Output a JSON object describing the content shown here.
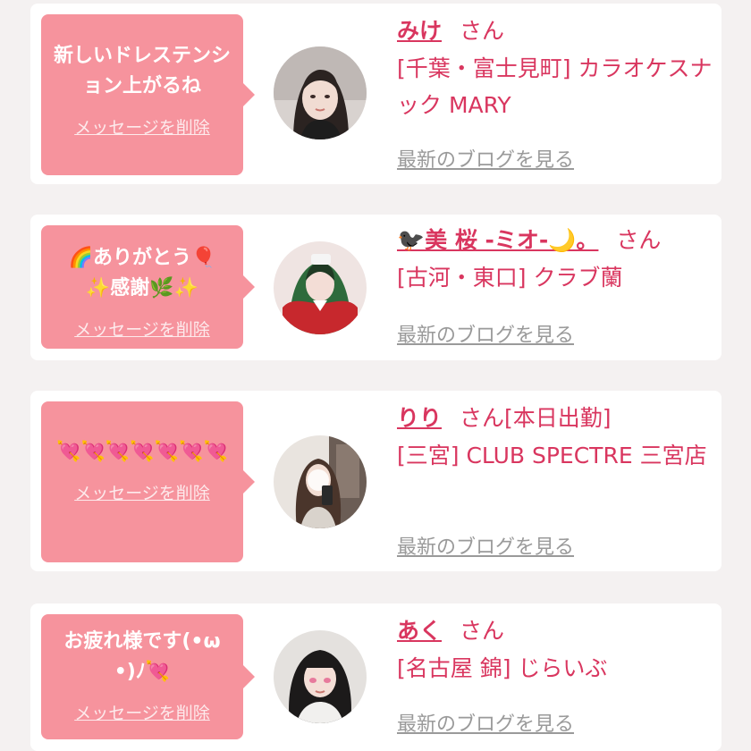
{
  "colors": {
    "page_bg": "#f4f1f1",
    "card_bg": "#ffffff",
    "bubble_bg": "#f6939d",
    "accent": "#d9365f",
    "link_gray": "#9a9a9a"
  },
  "entries": [
    {
      "message": "新しいドレステンション上がるね",
      "delete_label": "メッセージを削除",
      "name": "みけ",
      "honorific": "さん",
      "status": "",
      "shop": "[千葉・富士見町] カラオケスナック MARY",
      "blog_label": "最新のブログを見る",
      "avatar_icon": "profile-photo"
    },
    {
      "message": "🌈ありがとう🎈✨感謝🌿✨",
      "delete_label": "メッセージを削除",
      "name": "🐦‍⬛美 桜 -ミオ-🌙。",
      "honorific": "さん",
      "status": "",
      "shop": "[古河・東口] クラブ蘭",
      "blog_label": "最新のブログを見る",
      "avatar_icon": "profile-photo"
    },
    {
      "message": "💘💘💘💘💘💘💘",
      "delete_label": "メッセージを削除",
      "name": "りり",
      "honorific": "さん",
      "status": "[本日出勤]",
      "shop": "[三宮] CLUB SPECTRE 三宮店",
      "blog_label": "最新のブログを見る",
      "avatar_icon": "profile-photo"
    },
    {
      "message": "お疲れ様です(•ω•)ﾉ💘",
      "delete_label": "メッセージを削除",
      "name": "あく",
      "honorific": "さん",
      "status": "",
      "shop": "[名古屋 錦] じらいぶ",
      "blog_label": "最新のブログを見る",
      "avatar_icon": "profile-photo"
    }
  ]
}
